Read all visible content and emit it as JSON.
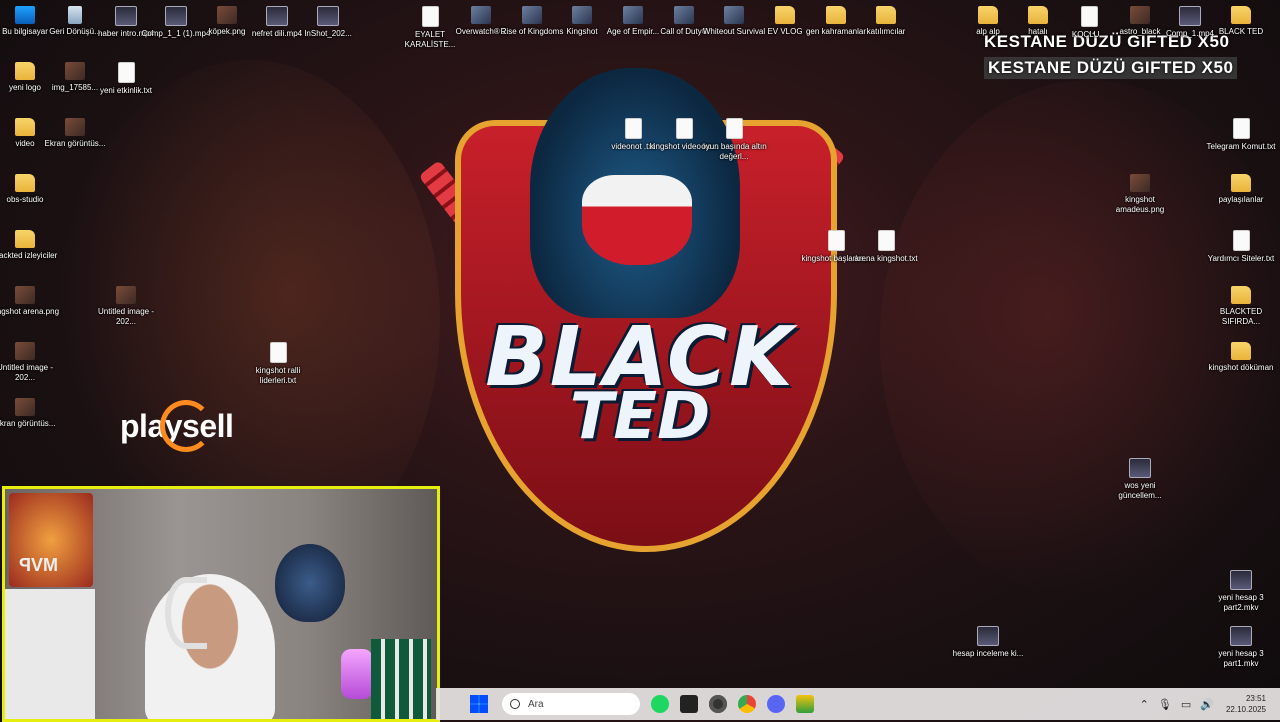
{
  "desktop": {
    "icons_top": [
      "Bu bilgisayar",
      "Geri Dönüşü...",
      "haber intro.mp4",
      "Comp_1_1 (1).mp4",
      "köpek.png",
      "nefret dili.mp4",
      "InShot_202...",
      "EYALET KARALİSTE...",
      "Overwatch® 2",
      "Rise of Kingdoms",
      "Kingshot",
      "Age of Empir...",
      "Call of Duty®",
      "Whiteout Survival",
      "EV VLOG",
      "gen kahramanlar",
      "katılımcılar"
    ],
    "icons_left": [
      "yeni logo",
      "img_17585...",
      "yeni etkinlik.txt",
      "video",
      "Ekran görüntüs...",
      "obs-studio",
      "blackted izleyiciler",
      "kingshot arena.png",
      "Untitled image - 202...",
      "Untitled image - 202...",
      "Ekran görüntüs...",
      "kingshot ralli liderleri.txt"
    ],
    "icons_center": [
      "videonot .txt",
      "kingshot video ko...",
      "oyun başında altın değerl...",
      "kingshot başlarke...",
      "arena kingshot.txt"
    ],
    "icons_right": [
      "alp alp",
      "hatalı",
      "KOÇLU...",
      "astro_black",
      "Comp_1.mp4",
      "BLACK TED",
      "Telegram Komut.txt",
      "kingshot amadeus.png",
      "paylaşılanlar",
      "Yardımcı Siteler.txt",
      "BLACKTED SIFIRDA...",
      "kingshot döküman",
      "wos yeni güncellem...",
      "yeni hesap 3 part2.mkv",
      "hesap inceleme ki...",
      "yeni hesap 3 part1.mkv"
    ]
  },
  "overlay": {
    "banner": "KESTANE DÜZÜ  GIFTED X50",
    "logo_line1": "BLACK",
    "logo_line2": "TED",
    "sponsor": "playsell",
    "webcam_poster": "MVP"
  },
  "taskbar": {
    "search_placeholder": "Ara",
    "time": "23:51",
    "date": "22.10.2025"
  },
  "colors": {
    "webcam_border": "#e6ee10",
    "shield_border": "#e6a330",
    "accent_red": "#c8202a"
  }
}
